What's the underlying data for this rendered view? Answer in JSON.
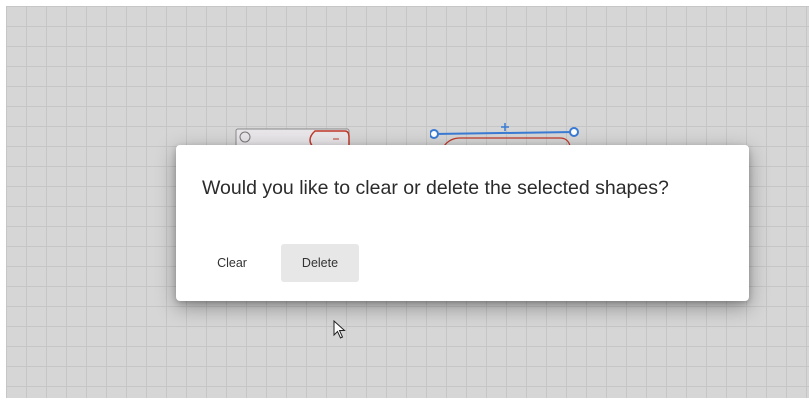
{
  "dialog": {
    "message": "Would you like to clear or delete the selected shapes?",
    "clear_label": "Clear",
    "delete_label": "Delete"
  },
  "icons": {
    "cursor": "mouse-pointer-icon",
    "resize_handle": "resize-handle-icon",
    "add_point": "plus-icon"
  },
  "colors": {
    "selection_accent": "#3a7bd5",
    "shape_outline_red": "#c0392b",
    "canvas_background": "#d6d6d6"
  }
}
